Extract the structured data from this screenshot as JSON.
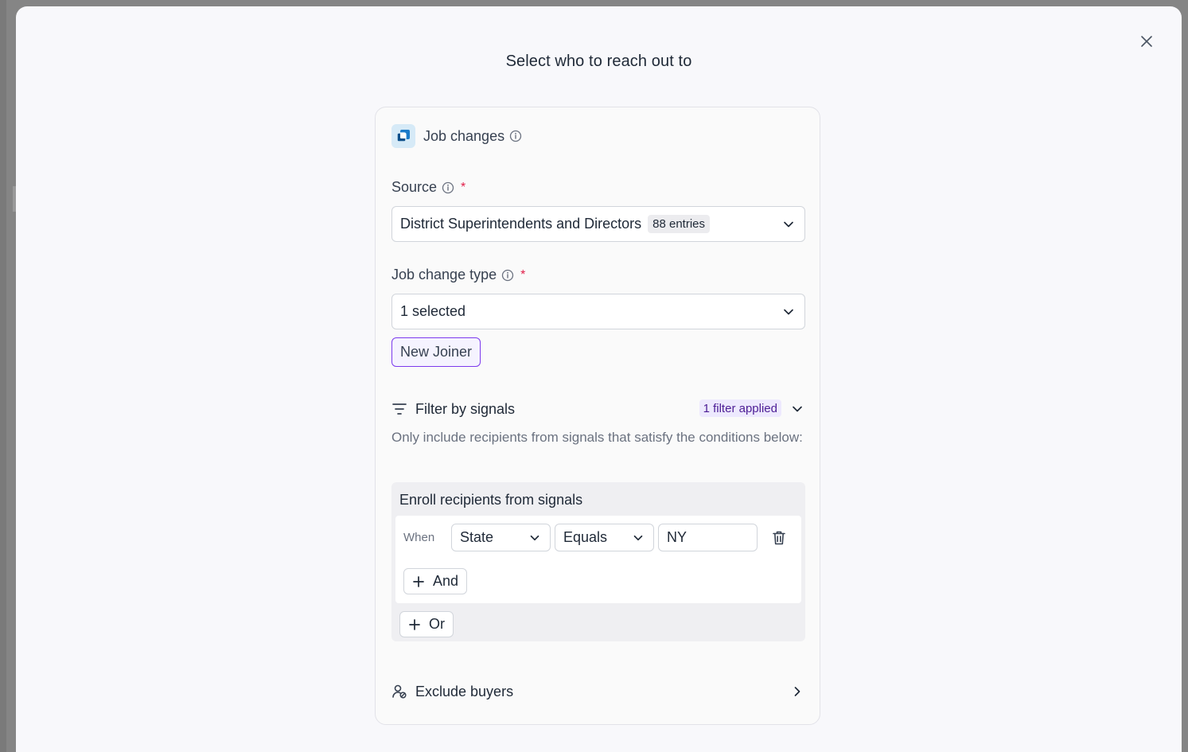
{
  "modal": {
    "title": "Select who to reach out to",
    "close_icon": "close-icon"
  },
  "card": {
    "header": {
      "title": "Job changes",
      "icon": "job-changes-app-icon",
      "info_icon": "info-icon"
    },
    "source": {
      "label": "Source",
      "required_mark": "*",
      "selected_value": "District Superintendents and Directors",
      "count_badge": "88 entries"
    },
    "job_change_type": {
      "label": "Job change type",
      "required_mark": "*",
      "selected_value": "1 selected",
      "tags": [
        "New Joiner"
      ]
    },
    "filter": {
      "title": "Filter by signals",
      "badge": "1 filter applied",
      "description": "Only include recipients from signals that satisfy the conditions below:",
      "panel_title": "Enroll recipients from signals",
      "condition": {
        "when_label": "When",
        "field": "State",
        "operator": "Equals",
        "value": "NY"
      },
      "and_label": "And",
      "or_label": "Or"
    },
    "exclude": {
      "title": "Exclude buyers"
    }
  },
  "colors": {
    "accent": "#7c3aed",
    "required": "#e11d48",
    "badge_bg": "#ede9fe",
    "badge_text": "#4c1d95"
  }
}
